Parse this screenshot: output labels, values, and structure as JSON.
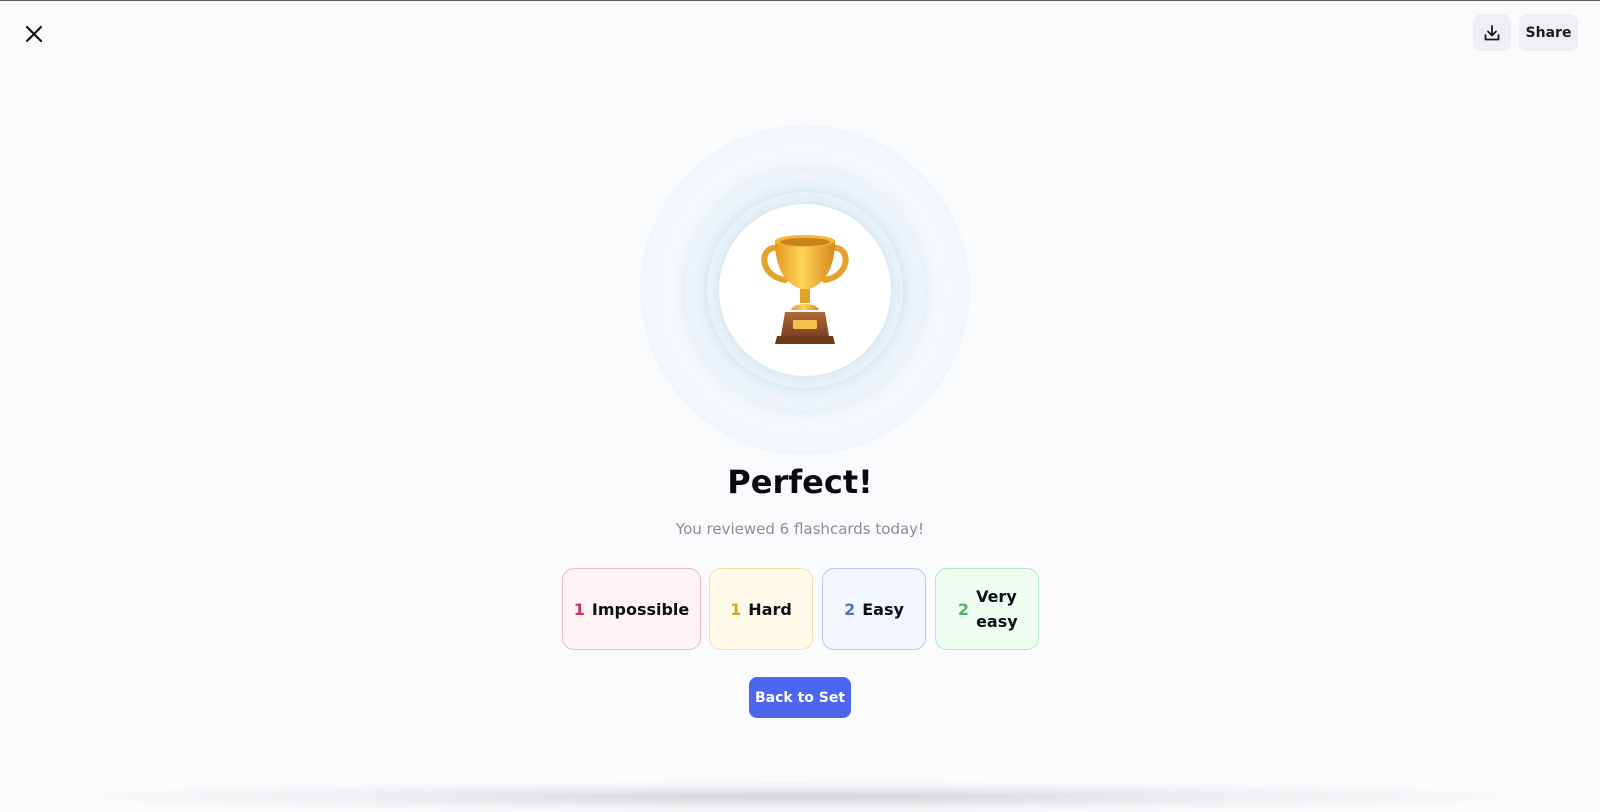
{
  "header": {
    "close_icon": "close-icon",
    "download_icon": "download-icon",
    "share_label": "Share"
  },
  "result": {
    "trophy_icon": "trophy-icon",
    "title": "Perfect!",
    "subtitle": "You reviewed 6 flashcards today!"
  },
  "stats": [
    {
      "count": "1",
      "label": "Impossible",
      "color": "#c4365d"
    },
    {
      "count": "1",
      "label": "Hard",
      "color": "#d3a525"
    },
    {
      "count": "2",
      "label": "Easy",
      "color": "#5572c2"
    },
    {
      "count": "2",
      "label": "Very easy",
      "color": "#51b36c"
    }
  ],
  "actions": {
    "back_label": "Back to Set"
  },
  "colors": {
    "accent": "#4d66f0",
    "background": "#fafbfd"
  }
}
